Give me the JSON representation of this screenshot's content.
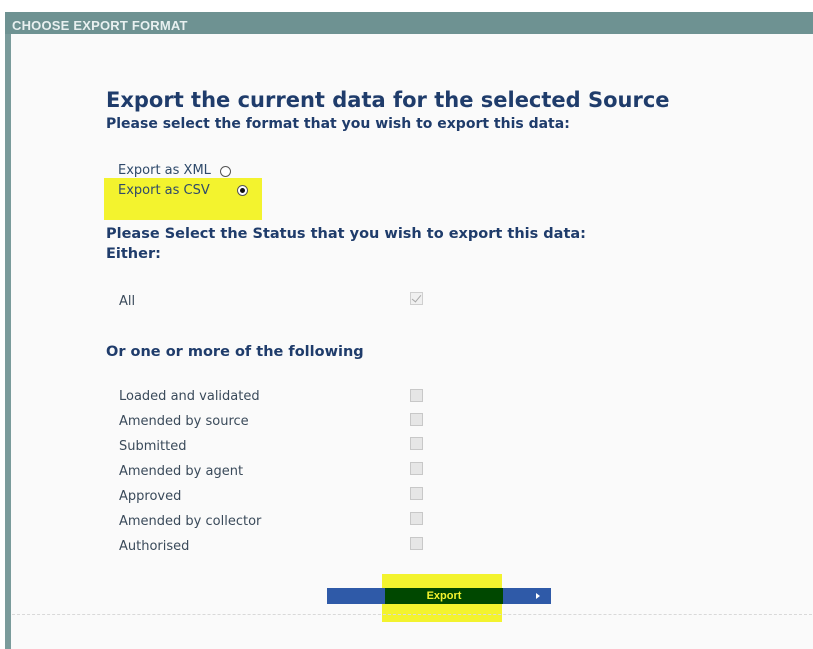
{
  "header": {
    "title": "CHOOSE EXPORT FORMAT"
  },
  "main": {
    "title": "Export the current data for the selected Source",
    "format_prompt": "Please select the format that you wish to export this data:",
    "format_options": [
      {
        "label": "Export as XML",
        "selected": false
      },
      {
        "label": "Export as CSV",
        "selected": true
      }
    ],
    "status_prompt": "Please Select the Status that you wish to export this data:",
    "either_label": "Either:",
    "all_option": {
      "label": "All",
      "checked": true
    },
    "or_heading": "Or one or more of the following",
    "statuses": [
      {
        "label": "Loaded and validated",
        "checked": false
      },
      {
        "label": "Amended by source",
        "checked": false
      },
      {
        "label": "Submitted",
        "checked": false
      },
      {
        "label": "Amended by agent",
        "checked": false
      },
      {
        "label": "Approved",
        "checked": false
      },
      {
        "label": "Amended by collector",
        "checked": false
      },
      {
        "label": "Authorised",
        "checked": false
      }
    ],
    "export_button": "Export"
  },
  "colors": {
    "heading": "#1f3c6b",
    "header_bar": "#6e9292",
    "highlight": "#f3f32e",
    "button_bar": "#2f5aa8",
    "button_fill": "#004800"
  },
  "icons": {
    "export_arrow": "chevron-right-icon",
    "check": "check-icon"
  }
}
